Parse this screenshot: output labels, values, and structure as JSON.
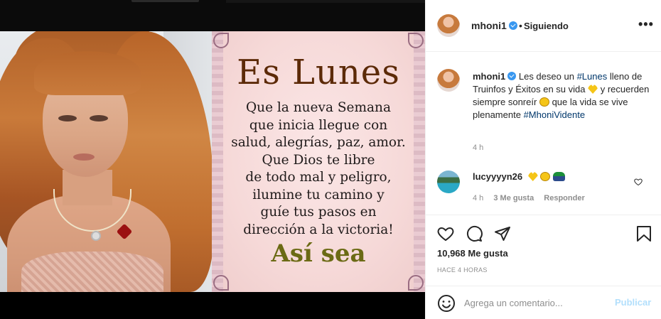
{
  "post": {
    "card": {
      "title": "Es Lunes",
      "lines": [
        "Que la nueva Semana",
        "que inicia llegue con",
        "salud, alegrías, paz, amor.",
        "Que Dios te libre",
        "de todo mal y peligro,",
        "ilumine tu camino y",
        "guíe tus pasos en",
        "dirección a la victoria!"
      ],
      "closing": "Así sea"
    }
  },
  "header": {
    "username": "mhoni1",
    "separator": "•",
    "follow_status": "Siguiendo",
    "more": "•••"
  },
  "caption": {
    "username": "mhoni1",
    "text_1": "Les deseo un",
    "tag_1": "#Lunes",
    "text_2": "lleno de Truinfos y Éxitos en su vida",
    "text_3": "y recuerden siempre sonreír",
    "text_4": "que la vida se vive plenamente",
    "tag_2": "#MhoniVidente",
    "time": "4 h"
  },
  "reply": {
    "username": "lucyyyyn26",
    "time": "4 h",
    "likes": "3 Me gusta",
    "reply_label": "Responder"
  },
  "actions": {
    "likes": "10,968 Me gusta",
    "ago": "HACE 4 HORAS"
  },
  "add_comment": {
    "placeholder": "Agrega un comentario...",
    "publish": "Publicar"
  },
  "colors": {
    "verified": "#3897f0",
    "link": "#00376b",
    "publish_disabled": "#b2dffc",
    "card_title": "#5c2a08",
    "card_closing": "#6b6a14"
  }
}
